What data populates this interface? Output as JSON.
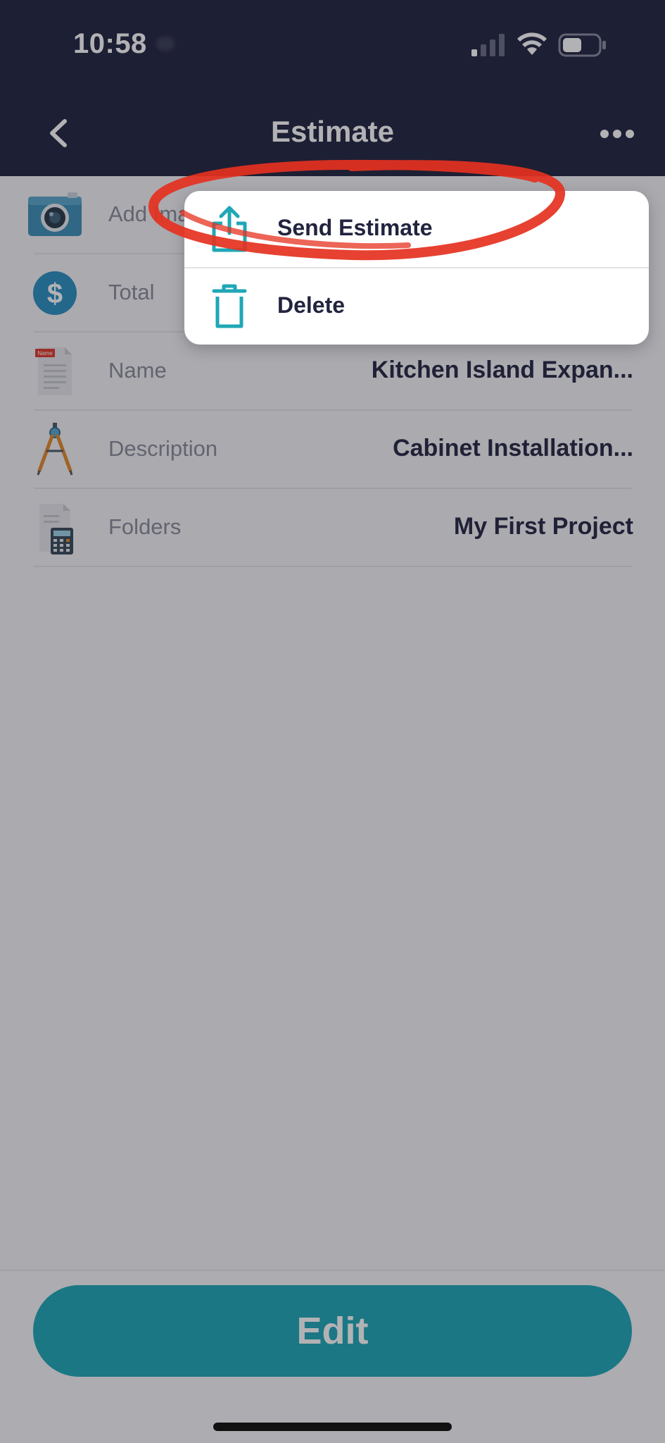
{
  "status_bar": {
    "time": "10:58",
    "signal_icon": "cellular-signal-icon",
    "wifi_icon": "wifi-icon",
    "battery_icon": "battery-icon"
  },
  "nav": {
    "title": "Estimate",
    "back_icon": "chevron-left-icon",
    "more_icon": "more-horizontal-icon"
  },
  "rows": [
    {
      "label": "Add Image",
      "value": "",
      "icon": "camera-icon"
    },
    {
      "label": "Total",
      "value": "",
      "icon": "dollar-icon"
    },
    {
      "label": "Name",
      "value": "Kitchen Island Expan...",
      "icon": "name-document-icon",
      "icon_badge": "Name"
    },
    {
      "label": "Description",
      "value": "Cabinet Installation...",
      "icon": "drafting-compass-icon"
    },
    {
      "label": "Folders",
      "value": "My First Project",
      "icon": "calculator-document-icon"
    }
  ],
  "menu": {
    "items": [
      {
        "label": "Send Estimate",
        "icon": "share-icon"
      },
      {
        "label": "Delete",
        "icon": "trash-icon"
      }
    ]
  },
  "footer": {
    "edit_label": "Edit"
  },
  "colors": {
    "nav_background": "#22243f",
    "accent_teal": "#1fa7b6",
    "annotation_red": "#e5311f"
  }
}
